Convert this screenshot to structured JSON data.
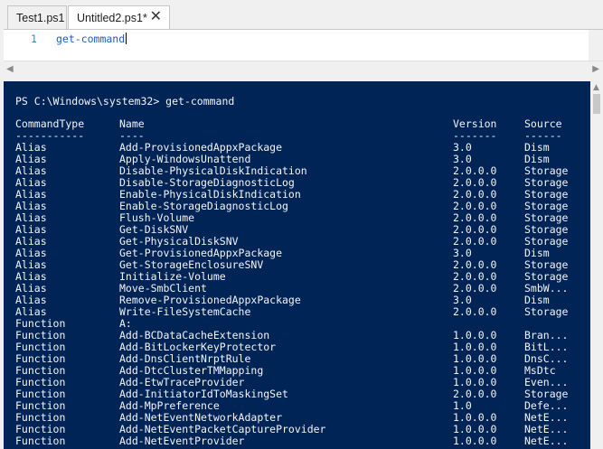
{
  "tabs": [
    {
      "label": "Test1.ps1"
    },
    {
      "label": "Untitled2.ps1*",
      "close": "✕"
    }
  ],
  "editor": {
    "line_number": "1",
    "code": "get-command"
  },
  "console": {
    "prompt": "PS C:\\Windows\\system32> get-command",
    "headers": {
      "type": "CommandType",
      "name": "Name",
      "version": "Version",
      "source": "Source"
    },
    "underlines": {
      "type": "-----------",
      "name": "----",
      "version": "-------",
      "source": "------"
    },
    "rows": [
      {
        "type": "Alias",
        "name": "Add-ProvisionedAppxPackage",
        "version": "3.0",
        "source": "Dism"
      },
      {
        "type": "Alias",
        "name": "Apply-WindowsUnattend",
        "version": "3.0",
        "source": "Dism"
      },
      {
        "type": "Alias",
        "name": "Disable-PhysicalDiskIndication",
        "version": "2.0.0.0",
        "source": "Storage"
      },
      {
        "type": "Alias",
        "name": "Disable-StorageDiagnosticLog",
        "version": "2.0.0.0",
        "source": "Storage"
      },
      {
        "type": "Alias",
        "name": "Enable-PhysicalDiskIndication",
        "version": "2.0.0.0",
        "source": "Storage"
      },
      {
        "type": "Alias",
        "name": "Enable-StorageDiagnosticLog",
        "version": "2.0.0.0",
        "source": "Storage"
      },
      {
        "type": "Alias",
        "name": "Flush-Volume",
        "version": "2.0.0.0",
        "source": "Storage"
      },
      {
        "type": "Alias",
        "name": "Get-DiskSNV",
        "version": "2.0.0.0",
        "source": "Storage"
      },
      {
        "type": "Alias",
        "name": "Get-PhysicalDiskSNV",
        "version": "2.0.0.0",
        "source": "Storage"
      },
      {
        "type": "Alias",
        "name": "Get-ProvisionedAppxPackage",
        "version": "3.0",
        "source": "Dism"
      },
      {
        "type": "Alias",
        "name": "Get-StorageEnclosureSNV",
        "version": "2.0.0.0",
        "source": "Storage"
      },
      {
        "type": "Alias",
        "name": "Initialize-Volume",
        "version": "2.0.0.0",
        "source": "Storage"
      },
      {
        "type": "Alias",
        "name": "Move-SmbClient",
        "version": "2.0.0.0",
        "source": "SmbW..."
      },
      {
        "type": "Alias",
        "name": "Remove-ProvisionedAppxPackage",
        "version": "3.0",
        "source": "Dism"
      },
      {
        "type": "Alias",
        "name": "Write-FileSystemCache",
        "version": "2.0.0.0",
        "source": "Storage"
      },
      {
        "type": "Function",
        "name": "A:",
        "version": "",
        "source": ""
      },
      {
        "type": "Function",
        "name": "Add-BCDataCacheExtension",
        "version": "1.0.0.0",
        "source": "Bran..."
      },
      {
        "type": "Function",
        "name": "Add-BitLockerKeyProtector",
        "version": "1.0.0.0",
        "source": "BitL..."
      },
      {
        "type": "Function",
        "name": "Add-DnsClientNrptRule",
        "version": "1.0.0.0",
        "source": "DnsC..."
      },
      {
        "type": "Function",
        "name": "Add-DtcClusterTMMapping",
        "version": "1.0.0.0",
        "source": "MsDtc"
      },
      {
        "type": "Function",
        "name": "Add-EtwTraceProvider",
        "version": "1.0.0.0",
        "source": "Even..."
      },
      {
        "type": "Function",
        "name": "Add-InitiatorIdToMaskingSet",
        "version": "2.0.0.0",
        "source": "Storage"
      },
      {
        "type": "Function",
        "name": "Add-MpPreference",
        "version": "1.0",
        "source": "Defe..."
      },
      {
        "type": "Function",
        "name": "Add-NetEventNetworkAdapter",
        "version": "1.0.0.0",
        "source": "NetE..."
      },
      {
        "type": "Function",
        "name": "Add-NetEventPacketCaptureProvider",
        "version": "1.0.0.0",
        "source": "NetE..."
      },
      {
        "type": "Function",
        "name": "Add-NetEventProvider",
        "version": "1.0.0.0",
        "source": "NetE..."
      }
    ]
  }
}
